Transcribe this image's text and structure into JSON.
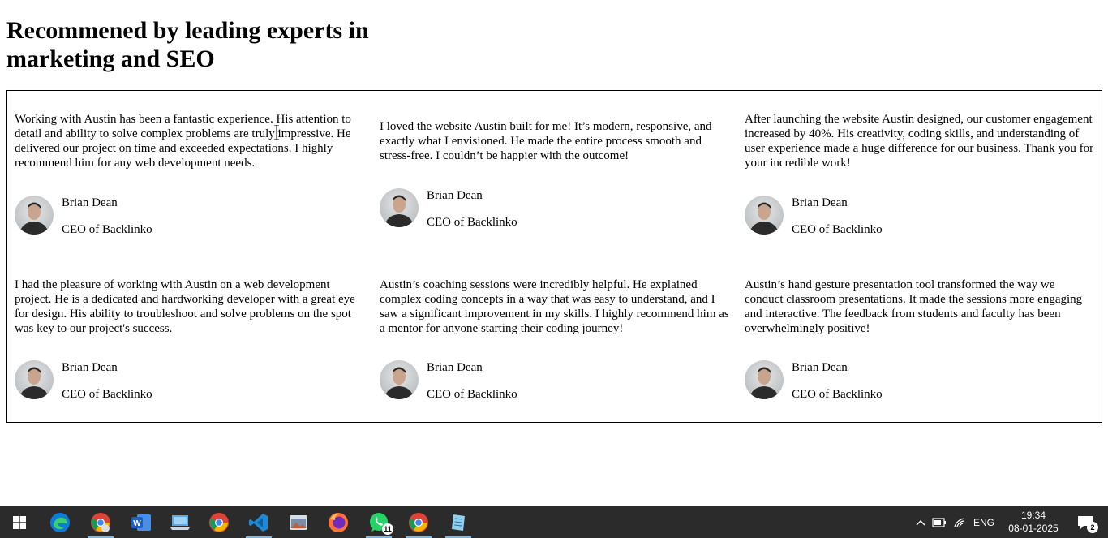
{
  "page": {
    "heading": "Recommened by leading experts in marketing and SEO"
  },
  "testimonials": [
    {
      "text": "Working with Austin has been a fantastic experience. His attention to detail and ability to solve complex problems are truly impressive. He delivered our project on time and exceeded expectations. I highly recommend him for any web development needs.",
      "name": "Brian Dean",
      "role": "CEO of Backlinko"
    },
    {
      "text": "I loved the website Austin built for me! It’s modern, responsive, and exactly what I envisioned. He made the entire process smooth and stress-free. I couldn’t be happier with the outcome!",
      "name": "Brian Dean",
      "role": "CEO of Backlinko"
    },
    {
      "text": "After launching the website Austin designed, our customer engagement increased by 40%. His creativity, coding skills, and understanding of user experience made a huge difference for our business. Thank you for your incredible work!",
      "name": "Brian Dean",
      "role": "CEO of Backlinko"
    },
    {
      "text": "I had the pleasure of working with Austin on a web development project. He is a dedicated and hardworking developer with a great eye for design. His ability to troubleshoot and solve problems on the spot was key to our project's success.",
      "name": "Brian Dean",
      "role": "CEO of Backlinko"
    },
    {
      "text": "Austin’s coaching sessions were incredibly helpful. He explained complex coding concepts in a way that was easy to understand, and I saw a significant improvement in my skills. I highly recommend him as a mentor for anyone starting their coding journey!",
      "name": "Brian Dean",
      "role": "CEO of Backlinko"
    },
    {
      "text": "Austin’s hand gesture presentation tool transformed the way we conduct classroom presentations. It made the sessions more engaging and interactive. The feedback from students and faculty has been overwhelmingly positive!",
      "name": "Brian Dean",
      "role": "CEO of Backlinko"
    }
  ],
  "taskbar": {
    "apps": [
      {
        "icon": "windows-start-icon"
      },
      {
        "icon": "edge-icon"
      },
      {
        "icon": "chrome-profile-icon",
        "active": true
      },
      {
        "icon": "word-icon"
      },
      {
        "icon": "file-explorer-pc-icon"
      },
      {
        "icon": "chrome-icon"
      },
      {
        "icon": "vscode-icon",
        "active": true
      },
      {
        "icon": "photos-icon"
      },
      {
        "icon": "firefox-icon"
      },
      {
        "icon": "whatsapp-icon",
        "badge": "11",
        "active": true
      },
      {
        "icon": "chrome-alt-icon",
        "active": true
      },
      {
        "icon": "notepad-icon",
        "active": true
      }
    ],
    "tray": {
      "language": "ENG",
      "time": "19:34",
      "date": "08-01-2025",
      "notification_count": "2"
    }
  },
  "colors": {
    "taskbar_bg": "#2b2b2b",
    "active_indicator": "#76b9ed"
  }
}
